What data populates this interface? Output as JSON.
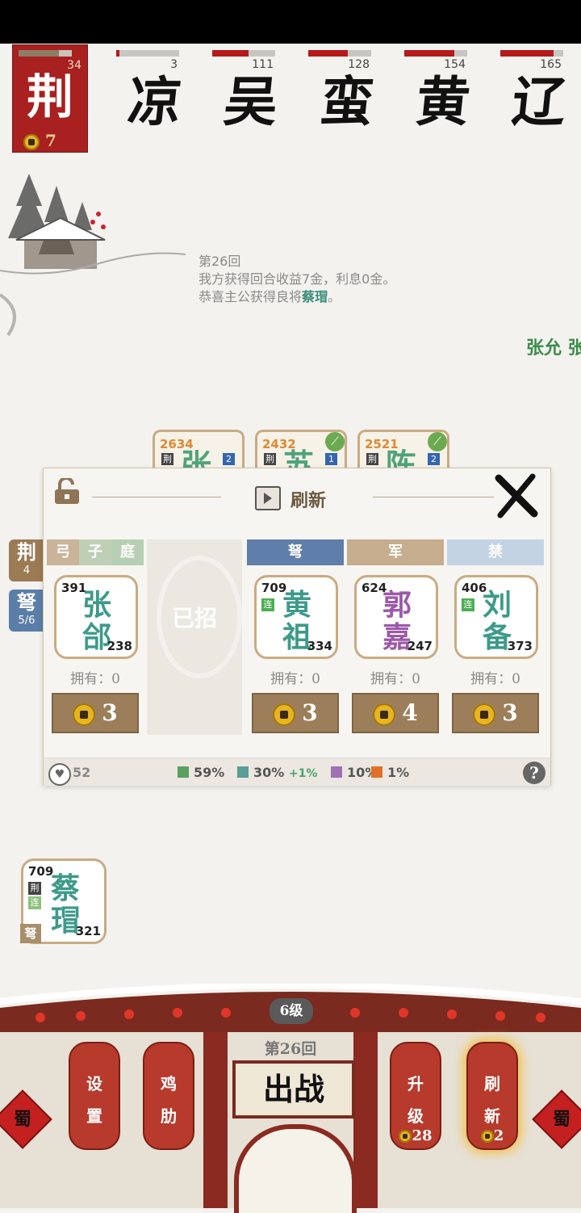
{
  "my_faction": {
    "name": "荆",
    "hp": 34,
    "hp_fraction": 0.75,
    "gold": "7"
  },
  "enemies": [
    {
      "name": "凉",
      "hp": "3",
      "hp_fraction": 0.05
    },
    {
      "name": "吴",
      "hp": "111",
      "hp_fraction": 0.58
    },
    {
      "name": "蛮",
      "hp": "128",
      "hp_fraction": 0.63
    },
    {
      "name": "黄",
      "hp": "154",
      "hp_fraction": 0.8
    },
    {
      "name": "辽",
      "hp": "165",
      "hp_fraction": 0.85
    }
  ],
  "log": {
    "line1": "第26回",
    "line2": "我方获得回合收益7金，利息0金。",
    "line3_prefix": "恭喜主公获得良将",
    "line3_name": "蔡瑁",
    "line3_suffix": "。"
  },
  "ticker": "张允 张",
  "side_tags": [
    {
      "glyph": "荆",
      "count": "4"
    },
    {
      "glyph": "弩",
      "count": "5/6"
    }
  ],
  "board_cards": [
    {
      "atk": "2634",
      "name": "张",
      "tag": "荆",
      "level": "2"
    },
    {
      "atk": "2432",
      "name": "苏",
      "tag": "荆",
      "level": "1"
    },
    {
      "atk": "2521",
      "name": "陈",
      "tag": "荆",
      "level": "2"
    }
  ],
  "shop": {
    "refresh_label": "刷新",
    "slots": [
      {
        "tags": [
          "弓",
          "子",
          "庭"
        ],
        "atk": "391",
        "name": "张郃",
        "hp": "238",
        "own": "拥有：0",
        "price": "3",
        "color": "#3d9a8a",
        "header_color": "#b9cdb5",
        "lian": false
      },
      {
        "taken": true,
        "label": "已招"
      },
      {
        "tags": [
          "弩"
        ],
        "atk": "709",
        "name": "黄祖",
        "hp": "334",
        "own": "拥有：0",
        "price": "3",
        "color": "#3d9a8a",
        "header_color": "#5f7eaa",
        "lian": true,
        "lian_label": "连"
      },
      {
        "tags": [
          "军"
        ],
        "atk": "624",
        "name": "郭嘉",
        "hp": "247",
        "own": "拥有：0",
        "price": "4",
        "color": "#9b59a8",
        "header_color": "#c6ad8e",
        "lian": false
      },
      {
        "tags": [
          "禁"
        ],
        "atk": "406",
        "name": "刘备",
        "hp": "373",
        "own": "拥有：0",
        "price": "3",
        "color": "#3d9a8a",
        "header_color": "#c4d3e4",
        "lian": true,
        "lian_label": "连"
      }
    ],
    "hearts": "52",
    "odds": [
      {
        "pct": "59%",
        "color": "#5aa160"
      },
      {
        "pct": "30%",
        "extra": "+1%",
        "color": "#5a9c98"
      },
      {
        "pct": "10%",
        "color": "#a070b4"
      },
      {
        "pct": "1%",
        "color": "#e0702a"
      }
    ],
    "help": "?"
  },
  "bench": {
    "atk": "709",
    "name": "蔡瑁",
    "hp": "321",
    "tag1": "荆",
    "tag2": "连",
    "tag3": "弩"
  },
  "bottom": {
    "level": "6级",
    "round": "第26回",
    "fight": "出战",
    "buttons": [
      {
        "l1": "设",
        "l2": "置"
      },
      {
        "l1": "鸡",
        "l2": "肋"
      },
      {
        "l1": "升",
        "l2": "级",
        "cost": "28"
      },
      {
        "l1": "刷",
        "l2": "新",
        "cost": "2"
      }
    ],
    "seal_text": "蜀"
  }
}
